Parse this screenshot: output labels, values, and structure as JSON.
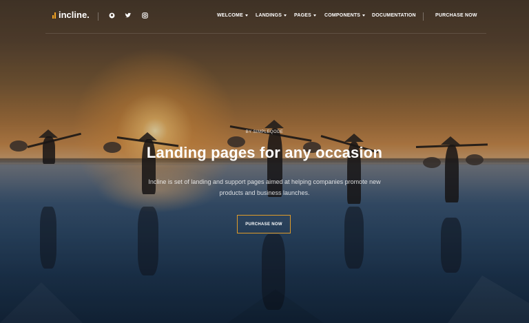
{
  "brand": {
    "name": "incline.",
    "accent": "#f5a623"
  },
  "social": [
    {
      "icon": "github-icon",
      "glyph": "●"
    },
    {
      "icon": "twitter-icon",
      "glyph": "✦"
    },
    {
      "icon": "instagram-icon",
      "glyph": "▣"
    }
  ],
  "nav": {
    "items": [
      {
        "label": "WELCOME",
        "dropdown": true
      },
      {
        "label": "LANDINGS",
        "dropdown": true
      },
      {
        "label": "PAGES",
        "dropdown": true
      },
      {
        "label": "COMPONENTS",
        "dropdown": true
      },
      {
        "label": "DOCUMENTATION",
        "dropdown": false
      }
    ],
    "purchase_label": "PURCHASE NOW"
  },
  "hero": {
    "eyebrow": "BY SIMPLEQODE",
    "title": "Landing pages for any occasion",
    "subtitle": "Incline is set of landing and support pages aimed at helping companies promote new products and business launches.",
    "cta_label": "PURCHASE NOW"
  }
}
